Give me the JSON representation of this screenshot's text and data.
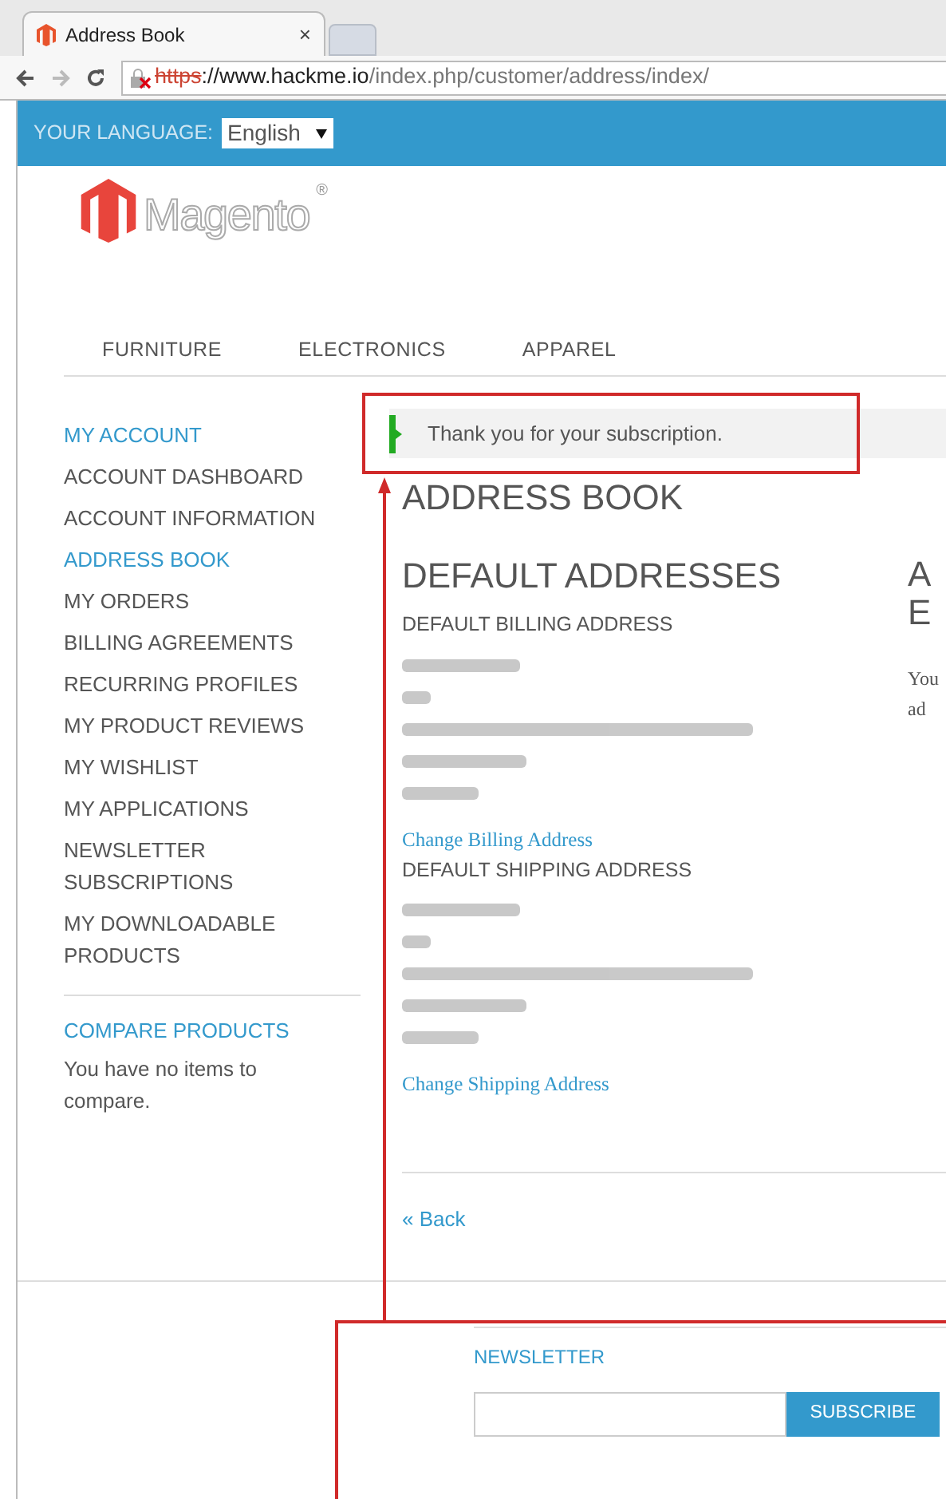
{
  "browser": {
    "tab_title": "Address Book",
    "tab_close": "×",
    "url_scheme": "https",
    "url_host": "://www.hackme.io",
    "url_path": "/index.php/customer/address/index/"
  },
  "top_bar": {
    "language_label": "YOUR LANGUAGE:",
    "language_value": "English"
  },
  "logo": {
    "text": "Magento",
    "mark": "®"
  },
  "nav": [
    "FURNITURE",
    "ELECTRONICS",
    "APPAREL"
  ],
  "sidebar": {
    "title": "MY ACCOUNT",
    "items": [
      {
        "label": "ACCOUNT DASHBOARD",
        "selected": false
      },
      {
        "label": "ACCOUNT INFORMATION",
        "selected": false
      },
      {
        "label": "ADDRESS BOOK",
        "selected": true
      },
      {
        "label": "MY ORDERS",
        "selected": false
      },
      {
        "label": "BILLING AGREEMENTS",
        "selected": false
      },
      {
        "label": "RECURRING PROFILES",
        "selected": false
      },
      {
        "label": "MY PRODUCT REVIEWS",
        "selected": false
      },
      {
        "label": "MY WISHLIST",
        "selected": false
      },
      {
        "label": "MY APPLICATIONS",
        "selected": false
      },
      {
        "label": "NEWSLETTER SUBSCRIPTIONS",
        "selected": false
      },
      {
        "label": "MY DOWNLOADABLE PRODUCTS",
        "selected": false
      }
    ],
    "compare_title": "COMPARE PRODUCTS",
    "compare_text": "You have no items to compare."
  },
  "message": "Thank you for your subscription.",
  "page_title": "ADDRESS BOOK",
  "default_addresses": {
    "title": "DEFAULT ADDRESSES",
    "sections": [
      {
        "title": "DEFAULT BILLING ADDRESS",
        "link": "Change Billing Address"
      },
      {
        "title": "DEFAULT SHIPPING ADDRESS",
        "link": "Change Shipping Address"
      }
    ]
  },
  "additional": {
    "heading_lines": [
      "A",
      "E"
    ],
    "text_lines": [
      "You",
      "ad"
    ]
  },
  "back_link": "« Back",
  "footer": {
    "newsletter_title": "NEWSLETTER",
    "subscribe_button": "SUBSCRIBE"
  }
}
